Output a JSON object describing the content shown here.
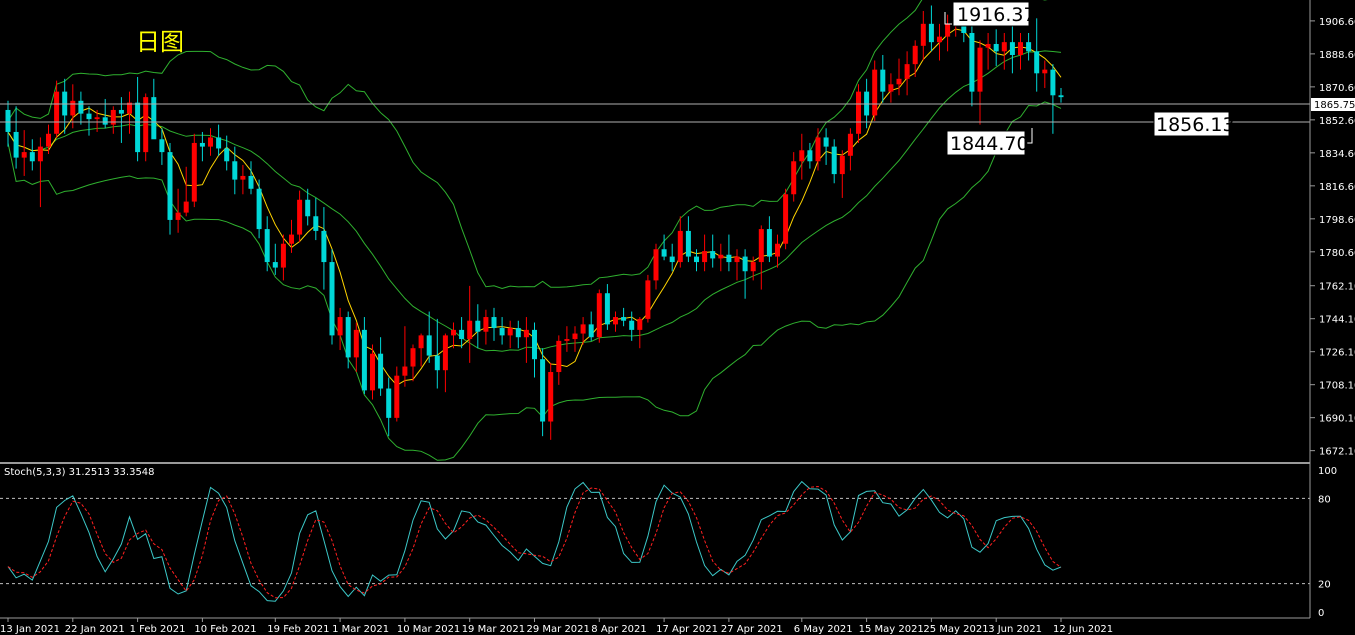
{
  "title_cn": "日图",
  "stoch_label": "Stoch(5,3,3) 31.2513 33.3548",
  "labels": {
    "high": "1916.37",
    "low": "1844.70",
    "level": "1856.13",
    "current": "1865.75"
  },
  "colors": {
    "bull": "#ff0000",
    "bear": "#00d8d8",
    "band": "#2fb02f",
    "ma": "#ffd400",
    "grid": "#808080",
    "stoch_main": "#3cc8c8",
    "stoch_signal": "#ff2020"
  },
  "chart_data": [
    {
      "type": "candlestick",
      "price_axis": {
        "ticks": [
          "1906.60",
          "1888.60",
          "1870.60",
          "1852.60",
          "1834.60",
          "1816.60",
          "1798.60",
          "1780.60",
          "1762.10",
          "1744.10",
          "1726.10",
          "1708.10",
          "1690.10",
          "1672.10"
        ],
        "range": [
          1667.0,
          1918.0
        ]
      },
      "date_ticks": [
        "13 Jan 2021",
        "22 Jan 2021",
        "1 Feb 2021",
        "10 Feb 2021",
        "19 Feb 2021",
        "1 Mar 2021",
        "10 Mar 2021",
        "19 Mar 2021",
        "29 Mar 2021",
        "8 Apr 2021",
        "17 Apr 2021",
        "27 Apr 2021",
        "6 May 2021",
        "15 May 2021",
        "25 May 2021",
        "3 Jun 2021",
        "12 Jun 2021"
      ],
      "candles": [
        [
          1858,
          1863,
          1838,
          1846
        ],
        [
          1846,
          1860,
          1826,
          1832
        ],
        [
          1832,
          1847,
          1822,
          1835
        ],
        [
          1835,
          1842,
          1825,
          1830
        ],
        [
          1830,
          1843,
          1805,
          1838
        ],
        [
          1838,
          1850,
          1834,
          1845
        ],
        [
          1845,
          1874,
          1843,
          1868
        ],
        [
          1868,
          1875,
          1845,
          1855
        ],
        [
          1855,
          1872,
          1848,
          1863
        ],
        [
          1863,
          1868,
          1850,
          1856
        ],
        [
          1856,
          1860,
          1844,
          1853
        ],
        [
          1853,
          1858,
          1846,
          1854
        ],
        [
          1854,
          1864,
          1848,
          1850
        ],
        [
          1850,
          1860,
          1845,
          1858
        ],
        [
          1858,
          1865,
          1840,
          1856
        ],
        [
          1856,
          1868,
          1845,
          1862
        ],
        [
          1862,
          1876,
          1830,
          1835
        ],
        [
          1835,
          1867,
          1830,
          1865
        ],
        [
          1865,
          1875,
          1855,
          1842
        ],
        [
          1842,
          1848,
          1828,
          1835
        ],
        [
          1835,
          1840,
          1790,
          1798
        ],
        [
          1798,
          1815,
          1791,
          1802
        ],
        [
          1802,
          1827,
          1800,
          1808
        ],
        [
          1808,
          1845,
          1805,
          1840
        ],
        [
          1840,
          1846,
          1830,
          1838
        ],
        [
          1838,
          1848,
          1833,
          1843
        ],
        [
          1843,
          1850,
          1833,
          1837
        ],
        [
          1837,
          1844,
          1825,
          1830
        ],
        [
          1830,
          1838,
          1812,
          1820
        ],
        [
          1820,
          1828,
          1812,
          1822
        ],
        [
          1822,
          1830,
          1812,
          1815
        ],
        [
          1815,
          1820,
          1788,
          1793
        ],
        [
          1793,
          1800,
          1770,
          1775
        ],
        [
          1775,
          1785,
          1768,
          1772
        ],
        [
          1772,
          1790,
          1765,
          1785
        ],
        [
          1785,
          1798,
          1780,
          1790
        ],
        [
          1790,
          1814,
          1786,
          1809
        ],
        [
          1809,
          1815,
          1795,
          1800
        ],
        [
          1800,
          1810,
          1787,
          1792
        ],
        [
          1792,
          1805,
          1760,
          1775
        ],
        [
          1775,
          1782,
          1730,
          1735
        ],
        [
          1735,
          1750,
          1727,
          1745
        ],
        [
          1745,
          1748,
          1717,
          1723
        ],
        [
          1723,
          1742,
          1715,
          1738
        ],
        [
          1738,
          1745,
          1703,
          1705
        ],
        [
          1705,
          1730,
          1700,
          1725
        ],
        [
          1725,
          1734,
          1702,
          1706
        ],
        [
          1706,
          1712,
          1680,
          1690
        ],
        [
          1690,
          1718,
          1688,
          1713
        ],
        [
          1713,
          1740,
          1707,
          1718
        ],
        [
          1718,
          1730,
          1710,
          1728
        ],
        [
          1728,
          1736,
          1718,
          1735
        ],
        [
          1735,
          1748,
          1720,
          1724
        ],
        [
          1724,
          1744,
          1706,
          1716
        ],
        [
          1716,
          1736,
          1704,
          1735
        ],
        [
          1735,
          1742,
          1728,
          1738
        ],
        [
          1738,
          1745,
          1728,
          1733
        ],
        [
          1733,
          1762,
          1720,
          1743
        ],
        [
          1743,
          1752,
          1728,
          1737
        ],
        [
          1737,
          1749,
          1730,
          1745
        ],
        [
          1745,
          1750,
          1732,
          1739
        ],
        [
          1739,
          1745,
          1730,
          1735
        ],
        [
          1735,
          1743,
          1728,
          1739
        ],
        [
          1739,
          1743,
          1728,
          1734
        ],
        [
          1734,
          1745,
          1720,
          1738
        ],
        [
          1738,
          1742,
          1712,
          1722
        ],
        [
          1722,
          1728,
          1680,
          1688
        ],
        [
          1688,
          1720,
          1678,
          1715
        ],
        [
          1715,
          1735,
          1708,
          1732
        ],
        [
          1732,
          1740,
          1726,
          1733
        ],
        [
          1733,
          1740,
          1726,
          1736
        ],
        [
          1736,
          1745,
          1730,
          1741
        ],
        [
          1741,
          1748,
          1732,
          1734
        ],
        [
          1734,
          1760,
          1731,
          1758
        ],
        [
          1758,
          1763,
          1738,
          1741
        ],
        [
          1741,
          1748,
          1737,
          1745
        ],
        [
          1745,
          1750,
          1740,
          1743
        ],
        [
          1743,
          1748,
          1732,
          1738
        ],
        [
          1738,
          1745,
          1728,
          1744
        ],
        [
          1744,
          1768,
          1742,
          1765
        ],
        [
          1765,
          1785,
          1760,
          1782
        ],
        [
          1782,
          1790,
          1776,
          1778
        ],
        [
          1778,
          1785,
          1770,
          1775
        ],
        [
          1775,
          1800,
          1772,
          1792
        ],
        [
          1792,
          1800,
          1775,
          1778
        ],
        [
          1778,
          1782,
          1770,
          1775
        ],
        [
          1775,
          1790,
          1770,
          1781
        ],
        [
          1781,
          1790,
          1772,
          1777
        ],
        [
          1777,
          1785,
          1770,
          1779
        ],
        [
          1779,
          1790,
          1770,
          1775
        ],
        [
          1775,
          1782,
          1765,
          1778
        ],
        [
          1778,
          1782,
          1755,
          1770
        ],
        [
          1770,
          1778,
          1765,
          1775
        ],
        [
          1775,
          1795,
          1760,
          1793
        ],
        [
          1793,
          1800,
          1775,
          1778
        ],
        [
          1778,
          1790,
          1772,
          1785
        ],
        [
          1785,
          1815,
          1782,
          1812
        ],
        [
          1812,
          1835,
          1808,
          1830
        ],
        [
          1830,
          1845,
          1820,
          1836
        ],
        [
          1836,
          1840,
          1826,
          1830
        ],
        [
          1830,
          1848,
          1825,
          1843
        ],
        [
          1843,
          1848,
          1828,
          1838
        ],
        [
          1838,
          1842,
          1818,
          1823
        ],
        [
          1823,
          1836,
          1810,
          1833
        ],
        [
          1833,
          1848,
          1825,
          1845
        ],
        [
          1845,
          1872,
          1840,
          1868
        ],
        [
          1868,
          1875,
          1848,
          1855
        ],
        [
          1855,
          1885,
          1852,
          1880
        ],
        [
          1880,
          1888,
          1862,
          1868
        ],
        [
          1868,
          1878,
          1862,
          1872
        ],
        [
          1872,
          1886,
          1866,
          1875
        ],
        [
          1875,
          1890,
          1866,
          1883
        ],
        [
          1883,
          1896,
          1876,
          1893
        ],
        [
          1893,
          1912,
          1885,
          1905
        ],
        [
          1905,
          1915,
          1890,
          1895
        ],
        [
          1895,
          1905,
          1885,
          1898
        ],
        [
          1898,
          1910,
          1890,
          1905
        ],
        [
          1905,
          1916,
          1898,
          1908
        ],
        [
          1908,
          1912,
          1895,
          1900
        ],
        [
          1900,
          1914,
          1860,
          1868
        ],
        [
          1868,
          1896,
          1850,
          1892
        ],
        [
          1892,
          1900,
          1880,
          1894
        ],
        [
          1894,
          1902,
          1882,
          1890
        ],
        [
          1890,
          1900,
          1880,
          1895
        ],
        [
          1895,
          1905,
          1878,
          1888
        ],
        [
          1888,
          1900,
          1880,
          1895
        ],
        [
          1895,
          1900,
          1885,
          1890
        ],
        [
          1890,
          1908,
          1868,
          1878
        ],
        [
          1878,
          1885,
          1870,
          1880
        ],
        [
          1880,
          1883,
          1845,
          1866
        ],
        [
          1866,
          1870,
          1862,
          1865
        ]
      ]
    },
    {
      "type": "line",
      "name": "Stoch(5,3,3)",
      "ylim": [
        0,
        100
      ],
      "levels": [
        20,
        80
      ],
      "ticks": [
        "100",
        "80",
        "20",
        "0"
      ],
      "main_line_value": 31.2513,
      "signal_line_value": 33.3548
    }
  ]
}
